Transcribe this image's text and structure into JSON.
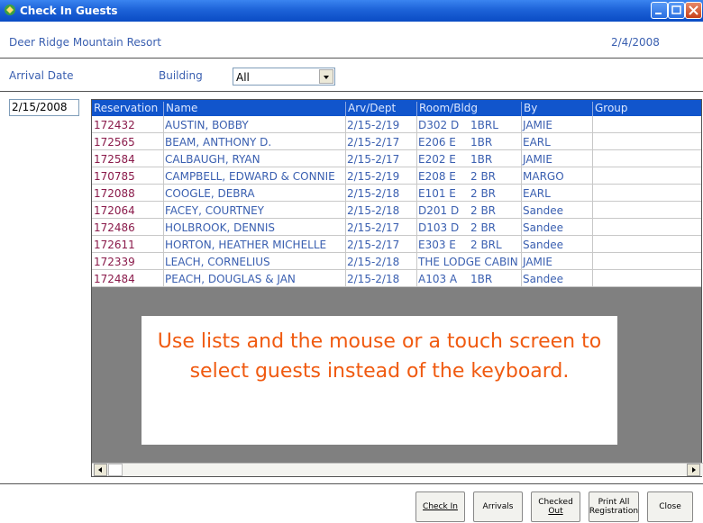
{
  "window": {
    "title": "Check In Guests"
  },
  "header": {
    "resort_name": "Deer Ridge Mountain Resort",
    "current_date": "2/4/2008"
  },
  "filters": {
    "arrival_date_label": "Arrival Date",
    "building_label": "Building",
    "building_value": "All",
    "arrival_date_value": "2/15/2008"
  },
  "grid": {
    "columns": [
      "Reservation",
      "Name",
      "Arv/Dept",
      "Room/Bldg",
      "By",
      "Group"
    ],
    "rows": [
      {
        "reservation": "172432",
        "name": "AUSTIN, BOBBY",
        "arv": "2/15-2/19",
        "room": "D302 D",
        "type": "1BRL",
        "by": "JAMIE",
        "group": ""
      },
      {
        "reservation": "172565",
        "name": "BEAM, ANTHONY  D.",
        "arv": "2/15-2/17",
        "room": "E206 E",
        "type": "1BR",
        "by": "EARL",
        "group": ""
      },
      {
        "reservation": "172584",
        "name": "CALBAUGH, RYAN",
        "arv": "2/15-2/17",
        "room": "E202 E",
        "type": "1BR",
        "by": "JAMIE",
        "group": ""
      },
      {
        "reservation": "170785",
        "name": "CAMPBELL, EDWARD & CONNIE",
        "arv": "2/15-2/19",
        "room": "E208 E",
        "type": "2 BR",
        "by": "MARGO",
        "group": ""
      },
      {
        "reservation": "172088",
        "name": "COOGLE, DEBRA",
        "arv": "2/15-2/18",
        "room": "E101 E",
        "type": "2 BR",
        "by": "EARL",
        "group": ""
      },
      {
        "reservation": "172064",
        "name": "FACEY, COURTNEY",
        "arv": "2/15-2/18",
        "room": "D201 D",
        "type": "2 BR",
        "by": "Sandee",
        "group": ""
      },
      {
        "reservation": "172486",
        "name": "HOLBROOK, DENNIS",
        "arv": "2/15-2/17",
        "room": "D103 D",
        "type": "2 BR",
        "by": "Sandee",
        "group": ""
      },
      {
        "reservation": "172611",
        "name": "HORTON, HEATHER MICHELLE",
        "arv": "2/15-2/17",
        "room": "E303 E",
        "type": "2 BRL",
        "by": "Sandee",
        "group": ""
      },
      {
        "reservation": "172339",
        "name": "LEACH, CORNELIUS",
        "arv": "2/15-2/18",
        "room": "THE LODGE CABIN",
        "type": "",
        "by": "JAMIE",
        "group": ""
      },
      {
        "reservation": "172484",
        "name": "PEACH, DOUGLAS & JAN",
        "arv": "2/15-2/18",
        "room": "A103 A",
        "type": "1BR",
        "by": "Sandee",
        "group": ""
      }
    ]
  },
  "overlay_text": "Use lists and the mouse or a touch screen to select guests instead of the keyboard.",
  "buttons": {
    "check_in": "Check In",
    "arrivals": "Arrivals",
    "checked_out_line1": "Checked",
    "checked_out_line2": "Out",
    "print_all_line1": "Print All",
    "print_all_line2": "Registration",
    "close": "Close"
  },
  "colors": {
    "titlebar": "#1d63d8",
    "grid_header": "#1155cc",
    "overlay_text": "#f05a10",
    "label_text": "#3a5fb0"
  }
}
